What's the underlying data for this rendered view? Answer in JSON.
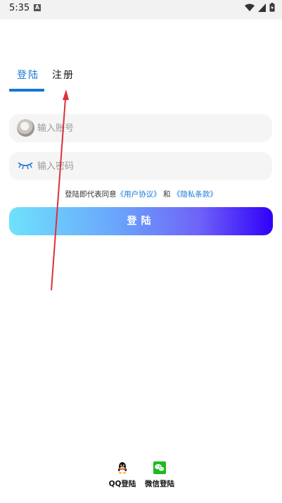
{
  "status_bar": {
    "time": "5:35",
    "badge": "A"
  },
  "tabs": {
    "login": "登陆",
    "register": "注册"
  },
  "account": {
    "placeholder": "输入账号"
  },
  "password": {
    "placeholder": "输入密码"
  },
  "agreement": {
    "prefix": "登陆即代表同意",
    "user_agreement": "《用户协议》",
    "and": "和",
    "privacy_policy": "《隐私条款》"
  },
  "login_button": {
    "label": "登陆"
  },
  "social": {
    "qq": "QQ登陆",
    "wechat": "微信登陆"
  },
  "colors": {
    "accent": "#1677d6",
    "gradient_start": "#70e1fb",
    "gradient_end": "#3000f8",
    "annotation": "#e0303a"
  },
  "icons": {
    "account": "avatar",
    "password": "eye-closed-icon",
    "qq": "qq-icon",
    "wechat": "wechat-icon"
  }
}
